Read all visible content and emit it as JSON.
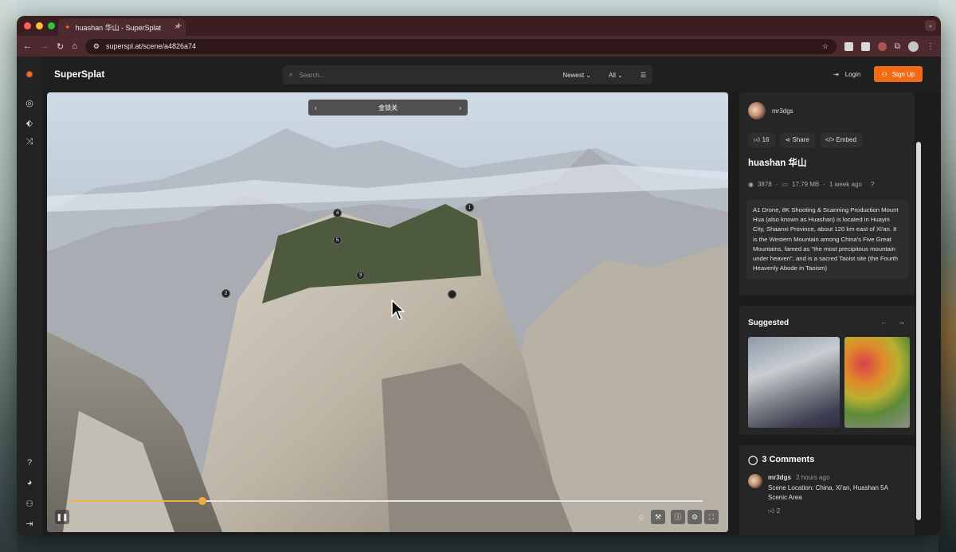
{
  "browser": {
    "tab_title": "huashan 华山 - SuperSplat",
    "new_tab": "+",
    "url": "superspl.at/scene/a4826a74"
  },
  "header": {
    "brand": "SuperSplat",
    "search_placeholder": "Search...",
    "sort": "Newest",
    "filter": "All",
    "login": "Login",
    "signup": "Sign Up"
  },
  "viewer": {
    "scene_name": "金锁关",
    "markers": [
      "4",
      "5",
      "3",
      "2",
      "1",
      ""
    ],
    "timeline_progress": 0.21
  },
  "scene": {
    "author": "mr3dgs",
    "likes": "16",
    "share": "Share",
    "embed": "Embed",
    "title": "huashan 华山",
    "views": "3878",
    "size": "17.79 MB",
    "age": "1 week ago",
    "description": "A1 Drone, 8K Shooting & Scanning Production Mount Hua (also known as Huashan) is located in Huayin City, Shaanxi Province, about 120 km east of Xi'an. It is the Western Mountain among China's Five Great Mountains, famed as \"the most precipitous mountain under heaven\", and is a sacred Taoist site (the Fourth Heavenly Abode in Taoism)"
  },
  "suggested": {
    "heading": "Suggested"
  },
  "comments": {
    "heading": "3 Comments",
    "items": [
      {
        "author": "mr3dgs",
        "time": "2 hours ago",
        "text": "Scene Location: China, Xi'an, Huashan 5A Scenic Area",
        "likes": "2"
      }
    ]
  },
  "colors": {
    "accent": "#f26a14",
    "tab_bg": "#3a1e22",
    "app_bg": "#1c1c1c"
  }
}
